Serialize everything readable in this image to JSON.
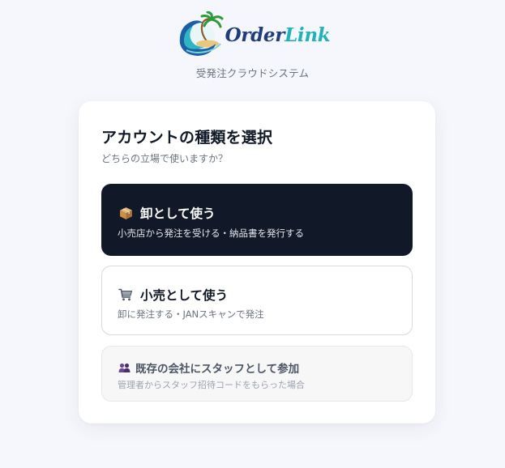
{
  "brand": {
    "logo_word_1": "Order",
    "logo_word_2": "Link",
    "tagline": "受発注クラウドシステム",
    "logo_icon": "wave-palm-island-logo"
  },
  "card": {
    "title": "アカウントの種類を選択",
    "subtitle": "どちらの立場で使いますか？"
  },
  "options": [
    {
      "icon": "package-icon",
      "title": "卸として使う",
      "description": "小売店から発注を受ける・納品書を発行する",
      "selected": true
    },
    {
      "icon": "shopping-cart-icon",
      "title": "小売として使う",
      "description": "卸に発注する・JANスキャンで発注",
      "selected": false
    },
    {
      "icon": "people-icon",
      "title": "既存の会社にスタッフとして参加",
      "description": "管理者からスタッフ招待コードをもらった場合",
      "selected": false
    }
  ],
  "colors": {
    "background": "#f6f7fc",
    "selected_card": "#111827",
    "brand_navy": "#1f3d7a",
    "brand_teal": "#1fb3b9"
  }
}
